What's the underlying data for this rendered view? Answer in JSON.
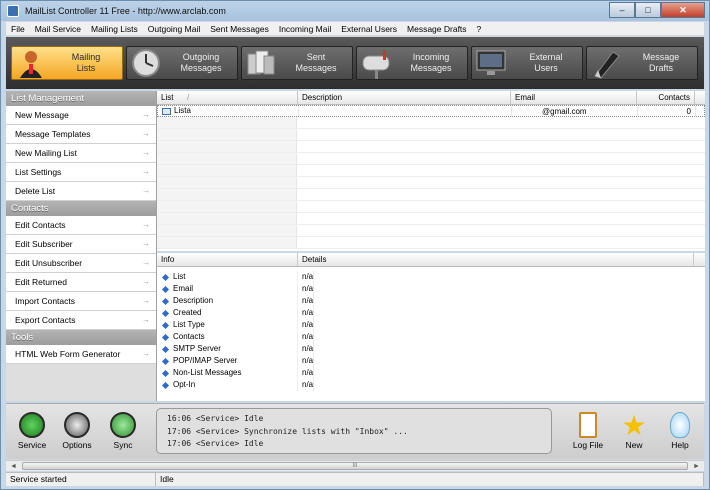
{
  "window": {
    "title": "MailList Controller 11 Free - http://www.arclab.com",
    "min_label": "–",
    "max_label": "□",
    "close_label": "✕"
  },
  "menu": [
    "File",
    "Mail Service",
    "Mailing Lists",
    "Outgoing Mail",
    "Sent Messages",
    "Incoming Mail",
    "External Users",
    "Message Drafts",
    "?"
  ],
  "toolbar": {
    "tabs": [
      {
        "line1": "Mailing",
        "line2": "Lists",
        "icon": "person-icon",
        "active": true
      },
      {
        "line1": "Outgoing",
        "line2": "Messages",
        "icon": "clock-icon",
        "active": false
      },
      {
        "line1": "Sent",
        "line2": "Messages",
        "icon": "stack-icon",
        "active": false
      },
      {
        "line1": "Incoming",
        "line2": "Messages",
        "icon": "mailbox-icon",
        "active": false
      },
      {
        "line1": "External",
        "line2": "Users",
        "icon": "monitor-icon",
        "active": false
      },
      {
        "line1": "Message",
        "line2": "Drafts",
        "icon": "pen-icon",
        "active": false
      }
    ]
  },
  "sidebar": {
    "list_management": "List Management",
    "list_items": [
      "New Message",
      "Message Templates",
      "New Mailing List",
      "List Settings",
      "Delete List"
    ],
    "contacts": "Contacts",
    "contact_items": [
      "Edit Contacts",
      "Edit Subscriber",
      "Edit Unsubscriber",
      "Edit Returned",
      "Import Contacts",
      "Export Contacts"
    ],
    "tools": "Tools",
    "tool_items": [
      "HTML Web Form Generator"
    ],
    "arrow": "→"
  },
  "list_grid": {
    "columns": [
      "List",
      "Description",
      "Email",
      "Contacts"
    ],
    "sort_glyph": "/",
    "rows": [
      {
        "list": "Lista",
        "description": "",
        "email": "@gmail.com",
        "contacts": "0"
      }
    ]
  },
  "info_grid": {
    "columns": [
      "Info",
      "Details"
    ],
    "rows": [
      {
        "info": "List",
        "details": "n/a"
      },
      {
        "info": "Email",
        "details": "n/a"
      },
      {
        "info": "Description",
        "details": "n/a"
      },
      {
        "info": "Created",
        "details": "n/a"
      },
      {
        "info": "List Type",
        "details": "n/a"
      },
      {
        "info": "Contacts",
        "details": "n/a"
      },
      {
        "info": "SMTP Server",
        "details": "n/a"
      },
      {
        "info": "POP/IMAP Server",
        "details": "n/a"
      },
      {
        "info": "Non-List Messages",
        "details": "n/a"
      },
      {
        "info": "Opt-In",
        "details": "n/a"
      }
    ]
  },
  "bottom": {
    "service": "Service",
    "options": "Options",
    "sync": "Sync",
    "logfile": "Log File",
    "new": "New",
    "help": "Help",
    "log_lines": [
      "16:06 <Service> Idle",
      "17:06 <Service> Synchronize lists with \"Inbox\" ...",
      "17:06 <Service> Idle"
    ]
  },
  "scroll": {
    "left": "◄",
    "right": "►",
    "grip": "III"
  },
  "status": {
    "left": "Service started",
    "right": "Idle"
  }
}
